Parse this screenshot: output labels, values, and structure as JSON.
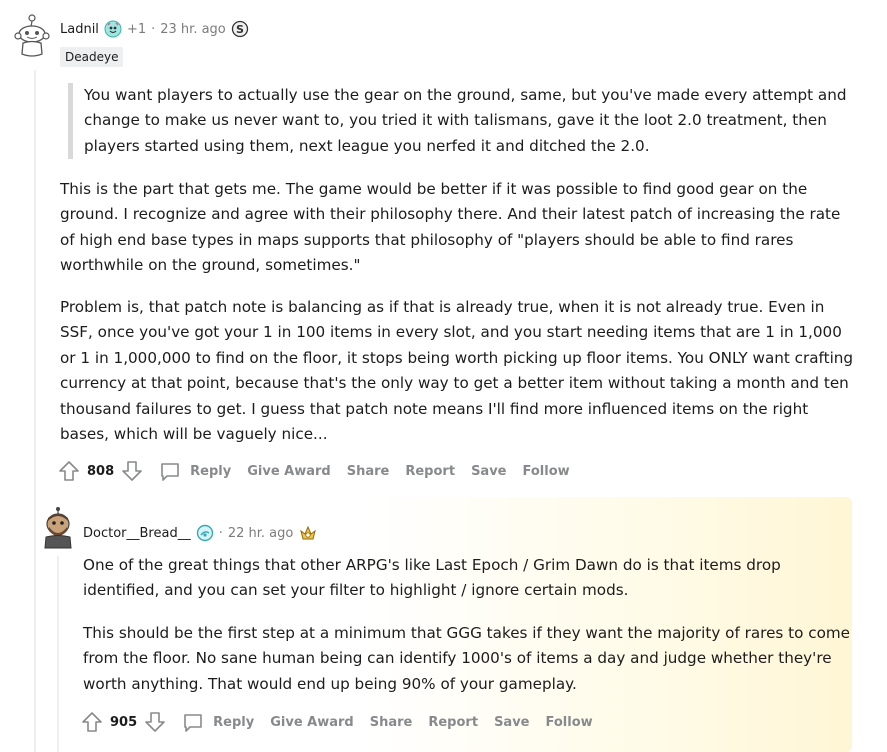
{
  "comment1": {
    "username": "Ladnil",
    "award_extra": "+1",
    "separator": "·",
    "timestamp": "23 hr. ago",
    "flair": "Deadeye",
    "quote": "You want players to actually use the gear on the ground, same, but you've made every attempt and change to make us never want to, you tried it with talismans, gave it the loot 2.0 treatment, then players started using them, next league you nerfed it and ditched the 2.0.",
    "paragraphs": [
      "This is the part that gets me. The game would be better if it was possible to find good gear on the ground. I recognize and agree with their philosophy there. And their latest patch of increasing the rate of high end base types in maps supports that philosophy of \"players should be able to find rares worthwhile on the ground, sometimes.\"",
      "Problem is, that patch note is balancing as if that is already true, when it is not already true. Even in SSF, once you've got your 1 in 100 items in every slot, and you start needing items that are 1 in 1,000 or 1 in 1,000,000 to find on the floor, it stops being worth picking up floor items. You ONLY want crafting currency at that point, because that's the only way to get a better item without taking a month and ten thousand failures to get. I guess that patch note means I'll find more influenced items on the right bases, which will be vaguely nice..."
    ],
    "votes": "808",
    "actions": [
      "Reply",
      "Give Award",
      "Share",
      "Report",
      "Save",
      "Follow"
    ]
  },
  "comment2": {
    "username": "Doctor__Bread__",
    "separator": "·",
    "timestamp": "22 hr. ago",
    "paragraphs": [
      "One of the great things that other ARPG's like Last Epoch / Grim Dawn do is that items drop identified, and you can set your filter to highlight / ignore certain mods.",
      "This should be the first step at a minimum that GGG takes if they want the majority of rares to come from the floor. No sane human being can identify 1000's of items a day and judge whether they're worth anything. That would end up being 90% of your gameplay."
    ],
    "votes": "905",
    "actions": [
      "Reply",
      "Give Award",
      "Share",
      "Report",
      "Save",
      "Follow"
    ]
  },
  "icons": {
    "upvote": "upvote-icon",
    "downvote": "downvote-icon",
    "comment": "comment-bubble-icon",
    "award": "award-icon",
    "snoo_avatar": "snoo-avatar-icon",
    "bread_avatar": "user-avatar-icon",
    "silver_award": "silver-award-icon",
    "gold_award": "gold-award-icon"
  },
  "colors": {
    "meta_gray": "#7c7c7c",
    "action_gray": "#878a8c",
    "quote_bar": "#d9d9d9",
    "flair_bg": "#edeff1",
    "highlight": "#fff6d5"
  }
}
